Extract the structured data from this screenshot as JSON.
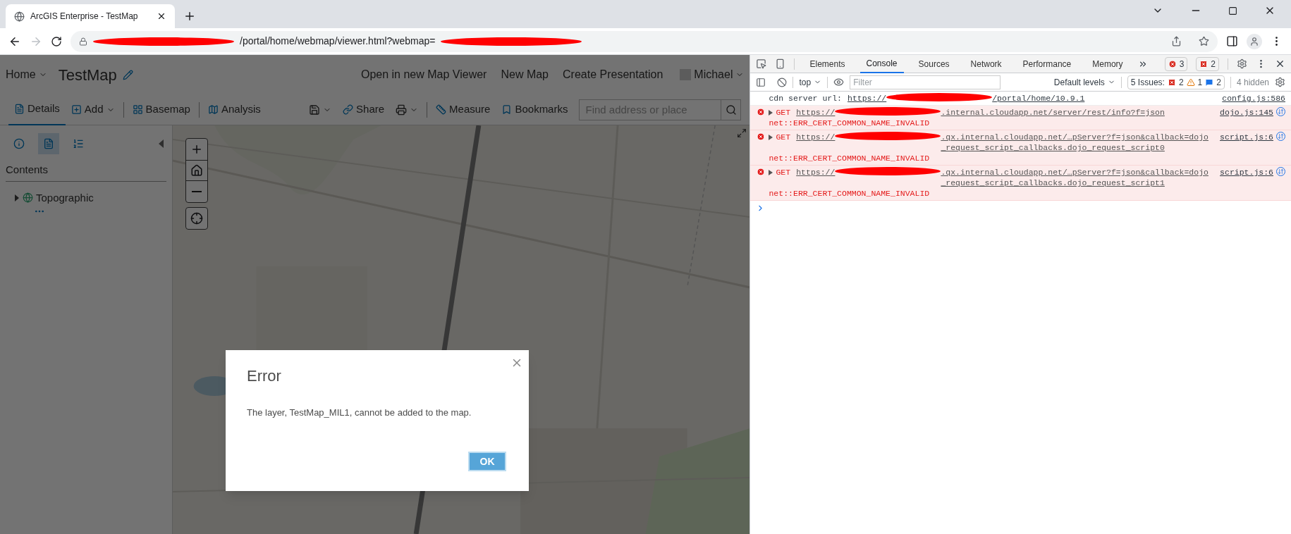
{
  "browser": {
    "tabs": [
      {
        "title": "ArcGIS Enterprise - TestMap",
        "selected": true
      }
    ],
    "forward_disabled": true,
    "address": {
      "segments": [
        {
          "kind": "redaction"
        },
        {
          "kind": "text",
          "text": "/portal/home/webmap/viewer.html?webmap="
        },
        {
          "kind": "redaction"
        }
      ]
    }
  },
  "app": {
    "home_menu": "Home",
    "map_title": "TestMap",
    "header_links": [
      "Open in new Map Viewer",
      "New Map",
      "Create Presentation"
    ],
    "user": "Michael",
    "toolbar_left": [
      {
        "kind": "details",
        "label": "Details",
        "selected": true
      },
      {
        "kind": "add",
        "label": "Add",
        "selected": false
      },
      {
        "kind": "basemap",
        "label": "Basemap",
        "selected": false
      },
      {
        "kind": "analysis",
        "label": "Analysis",
        "selected": false
      }
    ],
    "toolbar_right": [
      {
        "kind": "save"
      },
      {
        "kind": "share",
        "label": "Share"
      },
      {
        "kind": "print"
      },
      {
        "kind": "measure",
        "label": "Measure"
      },
      {
        "kind": "bookmarks",
        "label": "Bookmarks"
      }
    ],
    "search": {
      "placeholder": "Find address or place"
    },
    "panel_tabs": [
      {
        "kind": "about",
        "selected": false
      },
      {
        "kind": "content",
        "selected": true
      },
      {
        "kind": "legend",
        "selected": false
      }
    ],
    "contents_heading": "Contents",
    "layers": [
      {
        "name": "Topographic",
        "expanded": false
      }
    ],
    "map": {
      "kind": "picture"
    }
  },
  "dialog": {
    "title": "Error",
    "message": "The layer, TestMap_MIL1, cannot be added to the map.",
    "button": "OK"
  },
  "devtools": {
    "tabs": [
      {
        "label": "Elements",
        "selected": false
      },
      {
        "label": "Console",
        "selected": true
      },
      {
        "label": "Sources",
        "selected": false
      },
      {
        "label": "Network",
        "selected": false
      },
      {
        "label": "Performance",
        "selected": false
      },
      {
        "label": "Memory",
        "selected": false
      }
    ],
    "error_count": "3",
    "issue_count": "2",
    "context": "top",
    "filter": {
      "placeholder": "Filter"
    },
    "levels": "Default levels",
    "issues": {
      "label": "5 Issues:",
      "errors": "2",
      "warnings": "1",
      "info": "2"
    },
    "hidden": "4 hidden",
    "messages": [
      {
        "kind": "log",
        "text": "cdn server url:",
        "url_start": "https://",
        "url_end": "/portal/home/10.9.1",
        "source": "config.js:586"
      },
      {
        "kind": "error",
        "text": "GET",
        "url_start": "https://",
        "url_end": ".internal.cloudapp.net/server/rest/info?f=json",
        "error": "net::ERR_CERT_COMMON_NAME_INVALID",
        "source": "dojo.js:145"
      },
      {
        "kind": "error",
        "text": "GET",
        "url_start": "https://",
        "url_end": ".qx.internal.cloudapp.net/…pServer?f=json&callback=dojo_request_script_callbacks.dojo_request_script0",
        "error": "net::ERR_CERT_COMMON_NAME_INVALID",
        "source": "script.js:6"
      },
      {
        "kind": "error",
        "text": "GET",
        "url_start": "https://",
        "url_end": ".qx.internal.cloudapp.net/…pServer?f=json&callback=dojo_request_script_callbacks.dojo_request_script1",
        "error": "net::ERR_CERT_COMMON_NAME_INVALID",
        "source": "script.js:6"
      }
    ]
  }
}
